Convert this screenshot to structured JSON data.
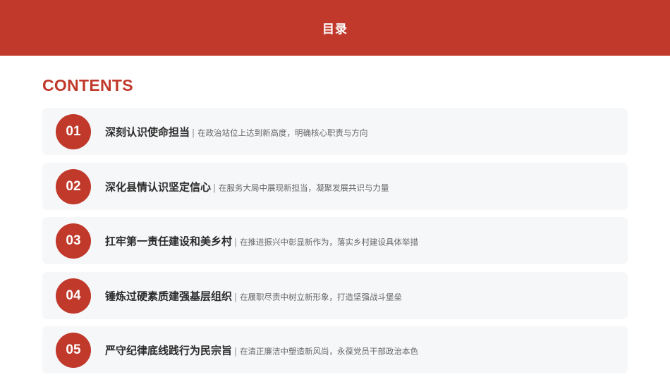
{
  "header": {
    "title": "目录"
  },
  "subtitle": "CONTENTS",
  "separator": "|",
  "items": [
    {
      "number": "01",
      "title": "深刻认识使命担当",
      "description": "在政治站位上达到新高度，明确核心职责与方向"
    },
    {
      "number": "02",
      "title": "深化县情认识坚定信心",
      "description": "在服务大局中展现新担当，凝聚发展共识与力量"
    },
    {
      "number": "03",
      "title": "扛牢第一责任建设和美乡村",
      "description": "在推进振兴中彰显新作为，落实乡村建设具体举措"
    },
    {
      "number": "04",
      "title": "锤炼过硬素质建强基层组织",
      "description": "在履职尽责中树立新形象，打造坚强战斗堡垒"
    },
    {
      "number": "05",
      "title": "严守纪律底线践行为民宗旨",
      "description": "在清正廉洁中塑造新风尚，永葆党员干部政治本色"
    }
  ],
  "colors": {
    "accent": "#c0392b",
    "card_background": "#f6f7f9"
  }
}
